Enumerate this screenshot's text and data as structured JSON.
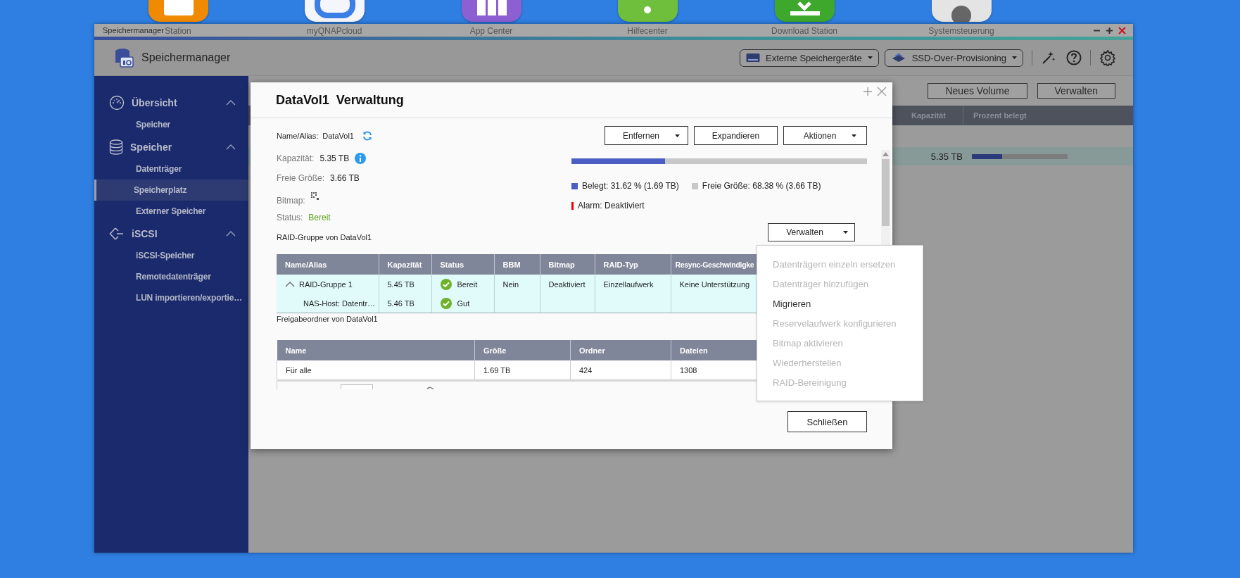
{
  "desktop_icons": [
    {
      "label": "Station",
      "color": "#f08a00"
    },
    {
      "label": "myQNAPcloud",
      "color": "#f4f6fb"
    },
    {
      "label": "App Center",
      "color": "#8c5fd2"
    },
    {
      "label": "Hilfecenter",
      "color": "#6fbe3c"
    },
    {
      "label": "Download Station",
      "color": "#3da82b"
    },
    {
      "label": "Systemsteuerung",
      "color": "#e4e4e4"
    }
  ],
  "window": {
    "title": "Speichermanager",
    "app_name": "Speichermanager",
    "header_buttons": [
      {
        "label": "Externe Speichergeräte",
        "kind": "disk"
      },
      {
        "label": "SSD-Over-Provisioning",
        "kind": "ssd"
      }
    ]
  },
  "sidebar": {
    "groups": [
      {
        "label": "Übersicht",
        "kind": "gauge",
        "expanded": true,
        "children": [
          {
            "label": "Speicher",
            "selected": false
          }
        ]
      },
      {
        "label": "Speicher",
        "kind": "database",
        "expanded": true,
        "children": [
          {
            "label": "Datenträger",
            "selected": false
          },
          {
            "label": "Speicherplatz",
            "selected": true
          },
          {
            "label": "Externer Speicher",
            "selected": false
          }
        ]
      },
      {
        "label": "iSCSI",
        "kind": "iscsi",
        "expanded": true,
        "children": [
          {
            "label": "iSCSI-Speicher",
            "selected": false
          },
          {
            "label": "Remotedatenträger",
            "selected": false
          },
          {
            "label": "LUN importieren/exportie…",
            "selected": false
          }
        ]
      }
    ]
  },
  "main": {
    "toolbar_buttons": [
      "Neues Volume",
      "Verwalten"
    ],
    "columns": [
      "Kapazität",
      "Prozent belegt"
    ],
    "rows": [
      {
        "capacity": "5.35 TB",
        "level": 0.316
      }
    ]
  },
  "dialog": {
    "title": "DataVol1  Verwaltung",
    "name_alias": {
      "label": "Name/Alias:",
      "value": "DataVol1"
    },
    "info": [
      {
        "label": "Kapazität:",
        "value": "5.35 TB",
        "kind": "info"
      },
      {
        "label": "Freie Größe:",
        "value": "3.66 TB",
        "kind": "text"
      },
      {
        "label": "Bitmap:",
        "kind": "bitmap"
      },
      {
        "label": "Status:",
        "value": "Bereit",
        "kind": "status"
      }
    ],
    "actions": [
      {
        "label": "Entfernen",
        "dropdown": true
      },
      {
        "label": "Expandieren",
        "dropdown": false
      },
      {
        "label": "Aktionen",
        "dropdown": true
      }
    ],
    "usage": {
      "level": 0.3162,
      "used": "Belegt: 31.62 % (1.69 TB)",
      "free": "Freie Größe: 68.38 % (3.66 TB)",
      "alarm": "Alarm: Deaktiviert"
    },
    "raid": {
      "title": "RAID-Gruppe von DataVol1",
      "manage_button": "Verwalten",
      "columns": [
        "Name/Alias",
        "Kapazität",
        "Status",
        "BBM",
        "Bitmap",
        "RAID-Typ",
        "Resync-Geschwindigke"
      ],
      "rows": [
        {
          "name": "RAID-Gruppe 1",
          "capacity": "5.45 TB",
          "status": "Bereit",
          "bbm": "Nein",
          "bitmap": "Deaktiviert",
          "raid_type": "Einzellaufwerk",
          "resync": "Keine Unterstützung",
          "expanded": true,
          "children": [
            {
              "name": "NAS-Host: Datentr…",
              "capacity": "5.46 TB",
              "status": "Gut"
            }
          ]
        }
      ]
    },
    "manage_menu": [
      {
        "label": "Datenträgern einzeln ersetzen",
        "disabled": true
      },
      {
        "label": "Datenträger hinzufügen",
        "disabled": true
      },
      {
        "label": "Migrieren",
        "disabled": false
      },
      {
        "label": "Reservelaufwerk konfigurieren",
        "disabled": true
      },
      {
        "label": "Bitmap aktivieren",
        "disabled": true
      },
      {
        "label": "Wiederherstellen",
        "disabled": true
      },
      {
        "label": "RAID-Bereinigung",
        "disabled": true
      }
    ],
    "shared": {
      "title": "Freigabeordner von DataVol1",
      "columns": [
        "Name",
        "Größe",
        "Ordner",
        "Dateien"
      ],
      "rows": [
        [
          "Für alle",
          "1.69 TB",
          "424",
          "1308"
        ]
      ]
    },
    "close_button": "Schließen"
  }
}
